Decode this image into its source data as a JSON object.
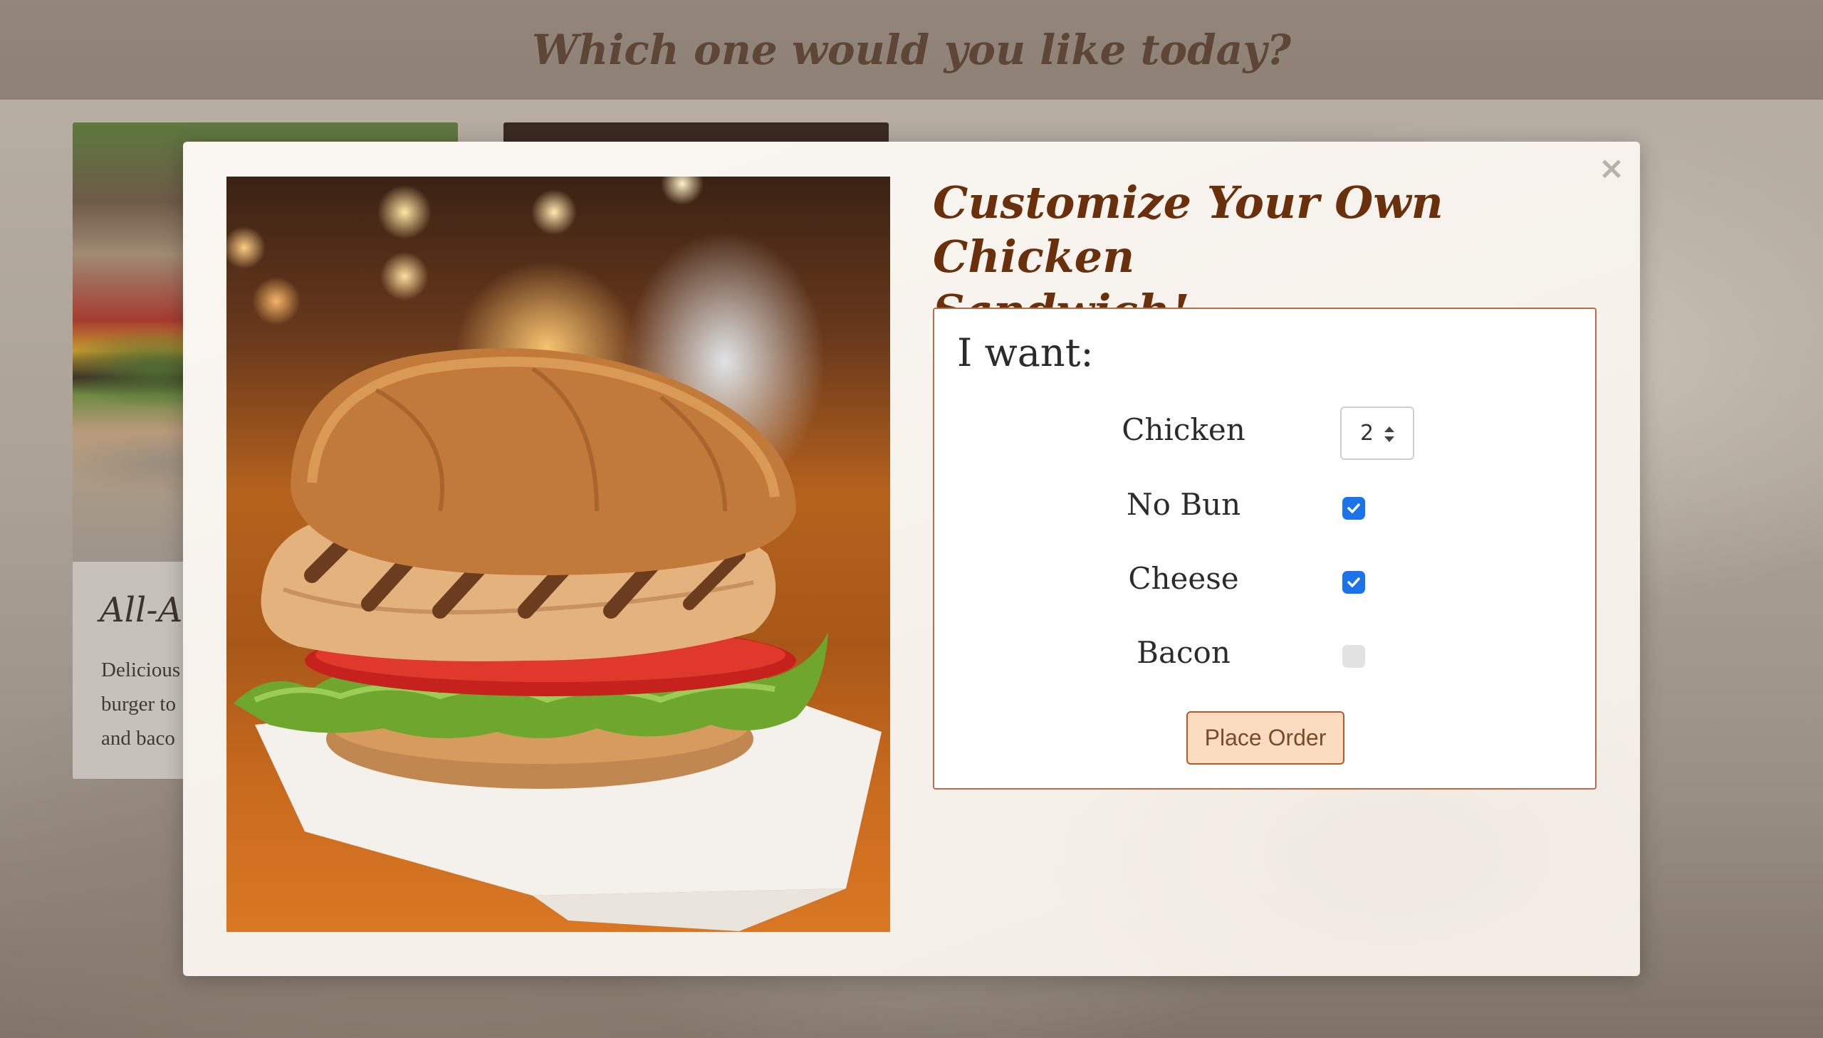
{
  "page": {
    "heading": "Which one would you like today?"
  },
  "background_card": {
    "title": "All-Am",
    "desc_lines": [
      "Delicious",
      "burger to",
      "and baco"
    ]
  },
  "modal": {
    "close_symbol": "×",
    "title_line1": "Customize Your Own Chicken",
    "title_line2": "Sandwich!",
    "form": {
      "heading": "I want:",
      "chicken_label": "Chicken",
      "chicken_qty": "2",
      "no_bun_label": "No Bun",
      "no_bun_checked": true,
      "cheese_label": "Cheese",
      "cheese_checked": true,
      "bacon_label": "Bacon",
      "bacon_checked": false,
      "submit_label": "Place Order"
    }
  },
  "colors": {
    "title": "#6a300c",
    "accent_checkbox": "#1a73e8",
    "button_bg": "#fcdcc0",
    "button_border": "#b8572a"
  }
}
